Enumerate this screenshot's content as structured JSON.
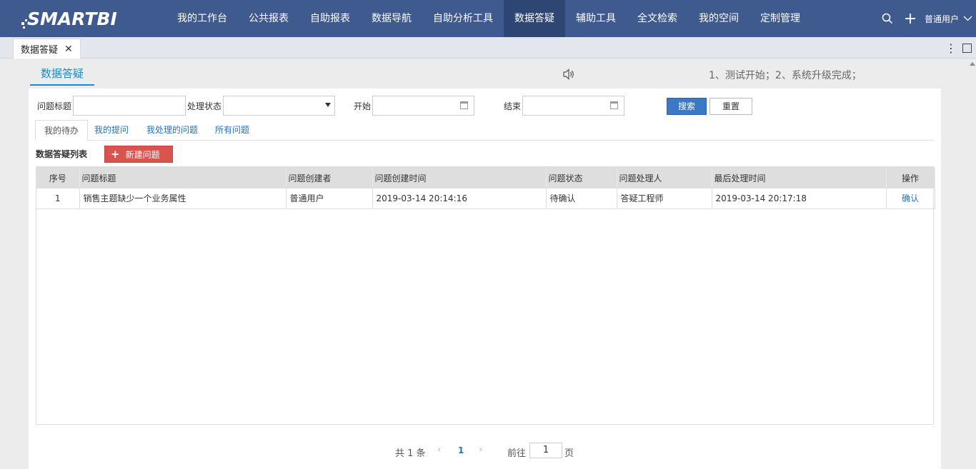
{
  "app": {
    "logo": "SMARTBI"
  },
  "nav": {
    "items": [
      "我的工作台",
      "公共报表",
      "自助报表",
      "数据导航",
      "自助分析工具",
      "数据答疑",
      "辅助工具",
      "全文检索",
      "我的空间",
      "定制管理"
    ],
    "active_index": 5
  },
  "user": {
    "name": "普通用户"
  },
  "tabs": [
    {
      "label": "数据答疑",
      "close": "✕"
    }
  ],
  "header": {
    "title": "数据答疑",
    "notice": "1、测试开始；2、系统升级完成；"
  },
  "filters": {
    "title_label": "问题标题",
    "title_value": "",
    "status_label": "处理状态",
    "status_value": "",
    "start_label": "开始",
    "start_value": "",
    "end_label": "结束",
    "end_value": "",
    "search_button": "搜索",
    "reset_button": "重置"
  },
  "subtabs": [
    "我的待办",
    "我的提问",
    "我处理的问题",
    "所有问题"
  ],
  "list": {
    "title": "数据答疑列表",
    "new_button": "新建问题",
    "new_button_icon": "+",
    "columns": [
      "序号",
      "问题标题",
      "问题创建者",
      "问题创建时间",
      "问题状态",
      "问题处理人",
      "最后处理时间",
      "操作"
    ],
    "rows": [
      [
        "1",
        "销售主题缺少一个业务属性",
        "普通用户",
        "2019-03-14 20:14:16",
        "待确认",
        "答疑工程师",
        "2019-03-14 20:17:18",
        "确认"
      ]
    ]
  },
  "pager": {
    "total": "共 1 条",
    "prev": "‹",
    "current": "1",
    "next": "›",
    "goto_label": "前往",
    "goto_value": "1",
    "page_suffix": "页"
  },
  "icons": {
    "search": "search-icon",
    "add": "plus-icon",
    "user_dropdown": "chevron-down-icon",
    "more": "kebab-icon",
    "maximize": "maximize-icon",
    "speaker": "speaker-icon",
    "calendar": "calendar-icon"
  },
  "colors": {
    "topbar": "#3f5a8e",
    "nav_active": "#2e4674",
    "accent": "#1a8cc8",
    "link": "#2a71b8",
    "search_button": "#3b78c5",
    "new_button": "#d9534f"
  }
}
